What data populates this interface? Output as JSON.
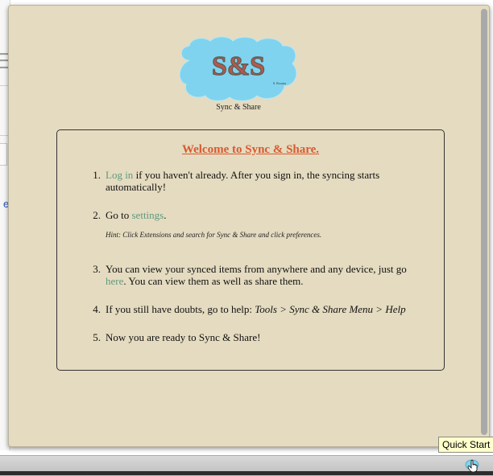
{
  "background": {
    "fragment_letter": "E",
    "fragment_link_letter": "e"
  },
  "panel": {
    "logo": {
      "text": "S&S",
      "subtext": "S. Kwatra"
    },
    "logo_caption": "Sync & Share",
    "welcome_title": "Welcome to Sync & Share.",
    "steps": [
      {
        "number": "1.",
        "link": "Log in",
        "text": " if you haven't already. After you sign in, the syncing starts automatically!"
      },
      {
        "number": "2.",
        "prefix": "Go to ",
        "link": "settings",
        "suffix": "."
      },
      {
        "number": "3.",
        "prefix": "You can view your synced items from anywhere and any device, just go ",
        "link": "here",
        "suffix": ". You can view them as well as share them."
      },
      {
        "number": "4.",
        "prefix": "If you still have doubts, go to help: ",
        "italic": "Tools > Sync & Share Menu > Help"
      },
      {
        "number": "5.",
        "text": "Now you are ready to Sync & Share!"
      }
    ],
    "hint": "Hint: Click Extensions and search for Sync & Share and click preferences."
  },
  "tooltip": "Quick Start",
  "colors": {
    "panel_bg": "#e5dbc0",
    "title": "#d85a2f",
    "link": "#5f9a7f",
    "cloud": "#7fd3ee"
  },
  "icons": {
    "status": "sync-share-status-icon",
    "cursor": "hand-cursor-icon"
  }
}
